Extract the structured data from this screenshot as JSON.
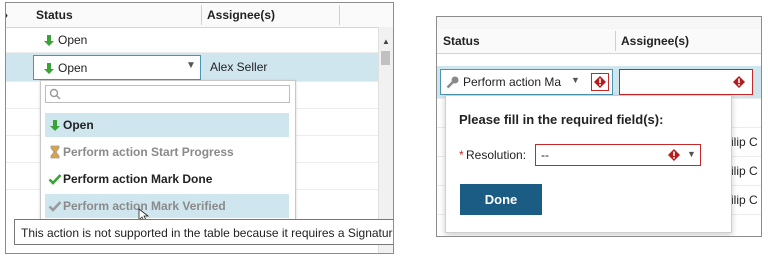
{
  "left_panel": {
    "columns": {
      "status": "Status",
      "assignee": "Assignee(s)"
    },
    "rows": [
      {
        "status": "Open",
        "assignee": ""
      },
      {
        "status": "Open",
        "assignee": "Alex Seller"
      }
    ],
    "dropdown": {
      "search_placeholder": "",
      "options": [
        {
          "label": "Open",
          "enabled": true,
          "highlighted": true,
          "icon": "open-status-icon"
        },
        {
          "label": "Perform action Start Progress",
          "enabled": false,
          "highlighted": false,
          "icon": "hourglass-icon"
        },
        {
          "label": "Perform action Mark Done",
          "enabled": true,
          "highlighted": false,
          "icon": "checkmark-icon"
        },
        {
          "label": "Perform action Mark Verified",
          "enabled": false,
          "highlighted": true,
          "icon": "checkmark-icon"
        }
      ]
    },
    "tooltip": "This action is not supported in the table because it requires a Signature."
  },
  "right_panel": {
    "columns": {
      "status": "Status",
      "assignee": "Assignee(s)"
    },
    "status_value": "Perform action Ma",
    "popup": {
      "heading": "Please fill in the required field(s):",
      "required_marker": "*",
      "field_label": "Resolution:",
      "field_value": "--",
      "done_label": "Done"
    },
    "background_rows": [
      "ilip C",
      "ilip C",
      "ilip C"
    ]
  },
  "colors": {
    "accent": "#1b5c84",
    "selection": "#cfe6ee",
    "error": "#c62828",
    "open_icon": "#3aa335"
  }
}
